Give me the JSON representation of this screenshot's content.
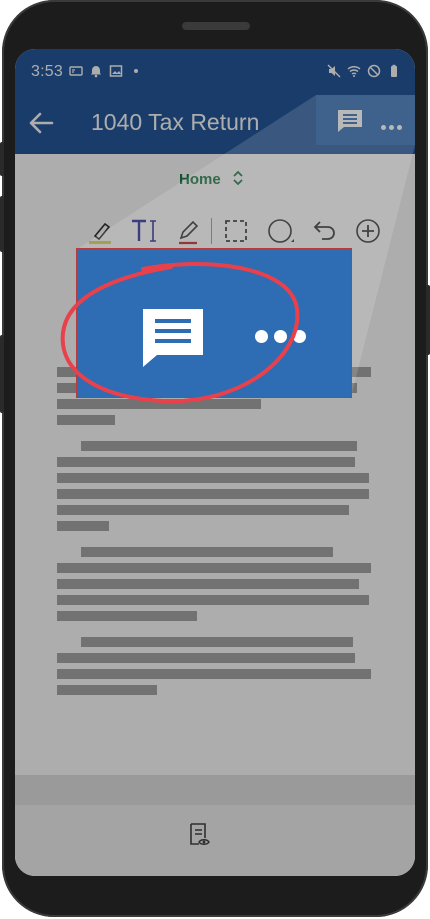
{
  "status_bar": {
    "time": "3:53",
    "left_icons": [
      "voicemail-icon",
      "alarm-icon",
      "image-icon",
      "dot-icon"
    ],
    "right_icons": [
      "mute-icon",
      "wifi-icon",
      "do-not-disturb-icon",
      "battery-icon"
    ]
  },
  "app_bar": {
    "title": "1040 Tax Return",
    "actions": [
      "comment-icon",
      "more-icon"
    ]
  },
  "toolbar": {
    "tab_label": "Home",
    "tools": [
      "highlighter-icon",
      "text-tool-icon",
      "pen-icon",
      "select-icon",
      "shape-icon",
      "undo-icon",
      "add-icon"
    ],
    "colors": {
      "highlighter": "#d8d84a",
      "text": "#2a2a9c",
      "pen": "#c02424"
    }
  },
  "document": {
    "paragraphs": 4
  },
  "bottom_nav": {
    "icons": [
      "document-view-icon"
    ]
  },
  "callout": {
    "icons": [
      "comment-icon",
      "more-icon"
    ],
    "accent": "#e8414b"
  },
  "colors": {
    "app_bar": "#25599c",
    "highlight_box": "#2e6cb3",
    "tab_text": "#1d7a45"
  }
}
